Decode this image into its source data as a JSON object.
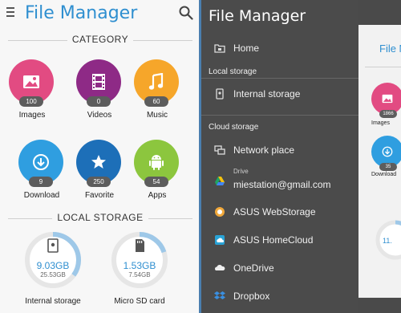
{
  "left": {
    "title": "File Manager",
    "category_header": "CATEGORY",
    "categories": [
      {
        "label": "Images",
        "count": "100",
        "color": "#e24b82",
        "icon": "image-icon"
      },
      {
        "label": "Videos",
        "count": "0",
        "color": "#8e2a86",
        "icon": "film-icon"
      },
      {
        "label": "Music",
        "count": "60",
        "color": "#f6a62a",
        "icon": "music-icon"
      },
      {
        "label": "Download",
        "count": "9",
        "color": "#2f9ee0",
        "icon": "download-icon"
      },
      {
        "label": "Favorite",
        "count": "250",
        "color": "#1d6fb8",
        "icon": "star-icon"
      },
      {
        "label": "Apps",
        "count": "54",
        "color": "#8cc63e",
        "icon": "android-icon"
      }
    ],
    "local_storage_header": "LOCAL STORAGE",
    "storage": [
      {
        "name": "Internal storage",
        "used": "9.03GB",
        "total": "25.53GB",
        "fraction": 0.35,
        "icon": "phone-storage-icon"
      },
      {
        "name": "Micro SD card",
        "used": "1.53GB",
        "total": "7.54GB",
        "fraction": 0.2,
        "icon": "sd-card-icon"
      }
    ]
  },
  "drawer": {
    "title": "File Manager",
    "home": "Home",
    "local_section": "Local storage",
    "internal": "Internal storage",
    "cloud_section": "Cloud storage",
    "network": "Network place",
    "drive_sub": "Drive",
    "drive_account": "miestation@gmail.com",
    "webstorage": "ASUS WebStorage",
    "homecloud": "ASUS HomeCloud",
    "onedrive": "OneDrive",
    "dropbox": "Dropbox"
  },
  "background": {
    "title": "File M",
    "images_count": "1866",
    "images_label": "Images",
    "download_count": "35",
    "download_label": "Download",
    "ring_text": "11."
  },
  "colors": {
    "accent": "#2f8fd0",
    "drawer_bg": "#4b4b4b",
    "badge": "#5d5d5d"
  }
}
